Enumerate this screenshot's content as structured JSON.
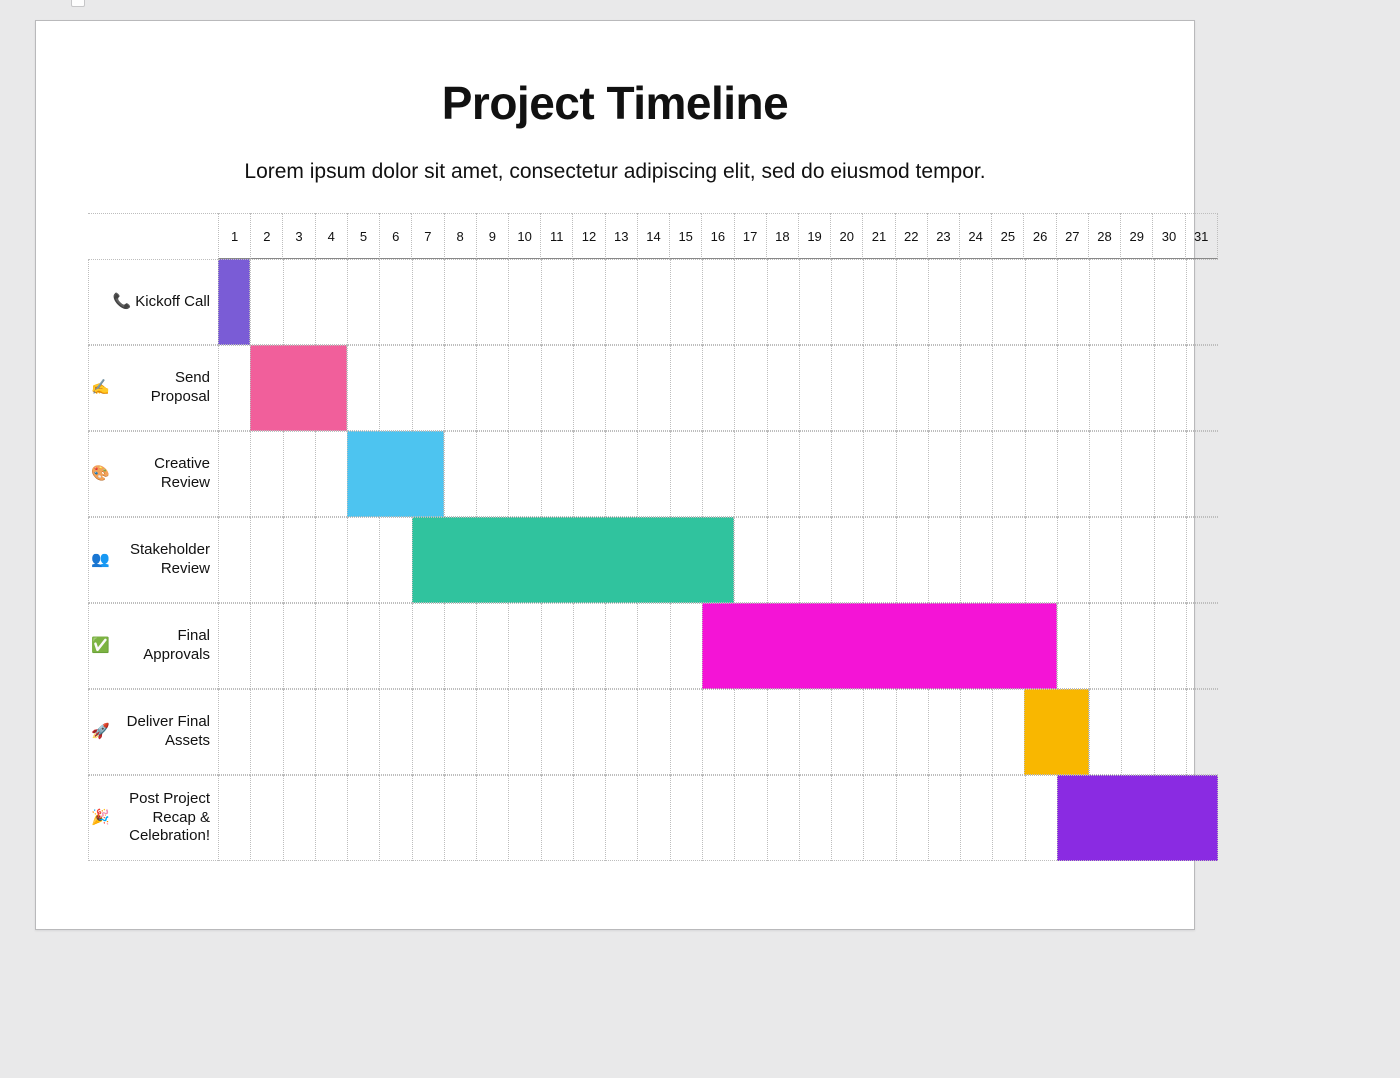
{
  "title": "Project Timeline",
  "subtitle": "Lorem ipsum dolor sit amet, consectetur adipiscing elit, sed do eiusmod tempor.",
  "chart_data": {
    "type": "bar",
    "orientation": "horizontal-gantt",
    "title": "Project Timeline",
    "xlabel": "",
    "ylabel": "",
    "x_axis_days": {
      "min": 1,
      "max": 31,
      "step": 1
    },
    "categories": [
      "Kickoff Call",
      "Send Proposal",
      "Creative Review",
      "Stakeholder Review",
      "Final Approvals",
      "Deliver Final Assets",
      "Post Project Recap & Celebration!"
    ],
    "days": [
      1,
      2,
      3,
      4,
      5,
      6,
      7,
      8,
      9,
      10,
      11,
      12,
      13,
      14,
      15,
      16,
      17,
      18,
      19,
      20,
      21,
      22,
      23,
      24,
      25,
      26,
      27,
      28,
      29,
      30,
      31
    ],
    "tasks": [
      {
        "label": "Kickoff Call",
        "emoji": "📞",
        "start": 1,
        "end": 1,
        "color": "#7a5cd6"
      },
      {
        "label": "Send Proposal",
        "emoji": "✍️",
        "start": 2,
        "end": 4,
        "color": "#f15f9b"
      },
      {
        "label": "Creative Review",
        "emoji": "🎨",
        "start": 5,
        "end": 7,
        "color": "#4dc4f0"
      },
      {
        "label": "Stakeholder Review",
        "emoji": "👥",
        "start": 7,
        "end": 16,
        "color": "#30c39e"
      },
      {
        "label": "Final Approvals",
        "emoji": "✅",
        "start": 16,
        "end": 26,
        "color": "#f414d6"
      },
      {
        "label": "Deliver Final Assets",
        "emoji": "🚀",
        "start": 26,
        "end": 27,
        "color": "#f9b700"
      },
      {
        "label": "Post Project Recap & Celebration!",
        "emoji": "🎉",
        "start": 27,
        "end": 31,
        "color": "#8a2be2"
      }
    ]
  }
}
